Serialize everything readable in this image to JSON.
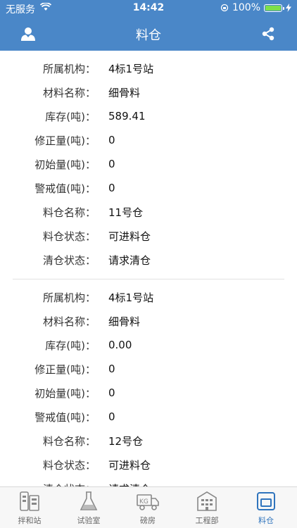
{
  "status": {
    "carrier": "无服务",
    "time": "14:42",
    "battery": "100%"
  },
  "nav": {
    "title": "料仓"
  },
  "records": [
    {
      "fields": [
        {
          "label": "所属机构：",
          "value": "4标1号站"
        },
        {
          "label": "材料名称：",
          "value": "细骨料"
        },
        {
          "label": "库存(吨)：",
          "value": "589.41"
        },
        {
          "label": "修正量(吨)：",
          "value": "0"
        },
        {
          "label": "初始量(吨)：",
          "value": "0"
        },
        {
          "label": "警戒值(吨)：",
          "value": "0"
        },
        {
          "label": "料仓名称：",
          "value": "11号仓"
        },
        {
          "label": "料仓状态：",
          "value": "可进料仓"
        },
        {
          "label": "清仓状态：",
          "value": "请求清仓"
        }
      ]
    },
    {
      "fields": [
        {
          "label": "所属机构：",
          "value": "4标1号站"
        },
        {
          "label": "材料名称：",
          "value": "细骨料"
        },
        {
          "label": "库存(吨)：",
          "value": "0.00"
        },
        {
          "label": "修正量(吨)：",
          "value": "0"
        },
        {
          "label": "初始量(吨)：",
          "value": "0"
        },
        {
          "label": "警戒值(吨)：",
          "value": "0"
        },
        {
          "label": "料仓名称：",
          "value": "12号仓"
        },
        {
          "label": "料仓状态：",
          "value": "可进料仓"
        },
        {
          "label": "清仓状态：",
          "value": "请求清仓"
        }
      ]
    }
  ],
  "tabs": [
    {
      "label": "拌和站",
      "icon": "building-icon"
    },
    {
      "label": "试验室",
      "icon": "flask-icon"
    },
    {
      "label": "磅房",
      "icon": "truck-scale-icon"
    },
    {
      "label": "工程部",
      "icon": "office-building-icon"
    },
    {
      "label": "料仓",
      "icon": "silo-icon",
      "active": true
    }
  ],
  "colors": {
    "primary": "#4a87c8",
    "active_tab": "#2f74bd"
  }
}
